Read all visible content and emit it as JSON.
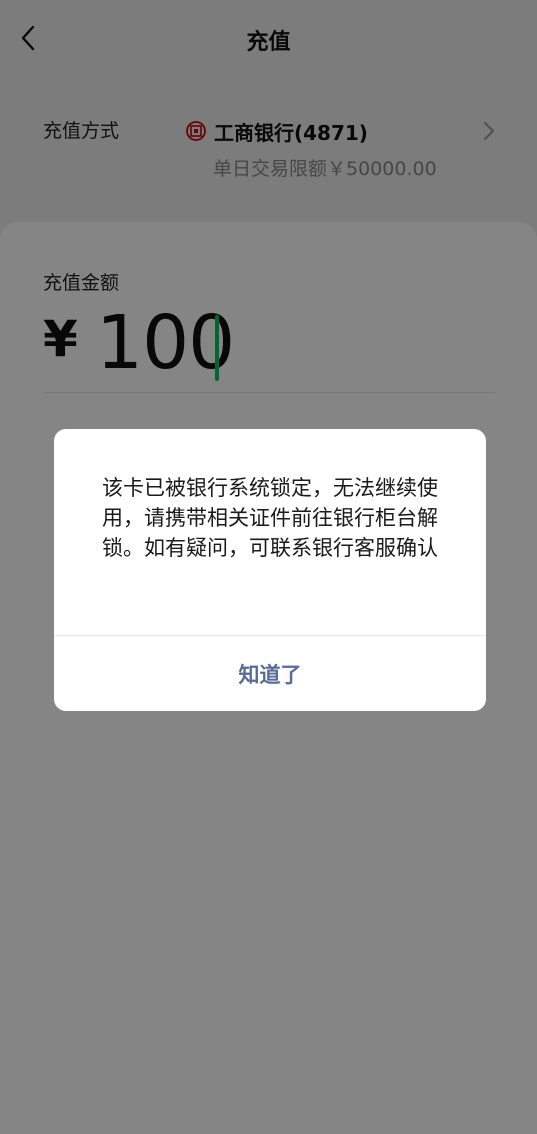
{
  "header": {
    "title": "充值"
  },
  "method": {
    "label": "充值方式",
    "bank_name": "工商银行(4871)",
    "limit": "单日交易限额￥50000.00"
  },
  "amount": {
    "label": "充值金额",
    "currency": "¥",
    "value": "100"
  },
  "dialog": {
    "message": "该卡已被银行系统锁定，无法继续使用，请携带相关证件前往银行柜台解锁。如有疑问，可联系银行客服确认",
    "button": "知道了"
  },
  "colors": {
    "cursor": "#07c160",
    "link": "#576b95",
    "bank_icon": "#c7000b"
  },
  "icons": [
    "back-arrow-icon",
    "bank-icbc-icon",
    "chevron-right-icon"
  ]
}
